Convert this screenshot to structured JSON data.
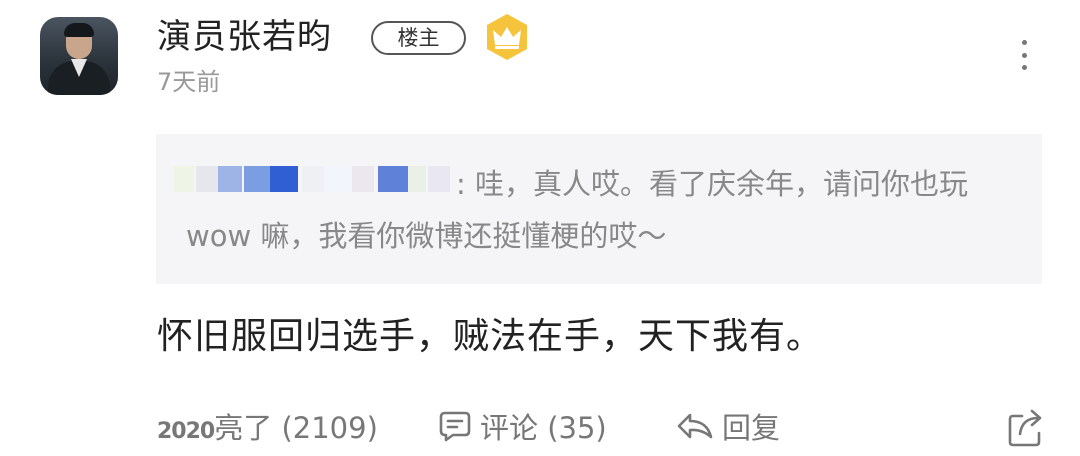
{
  "post": {
    "username": "演员张若昀",
    "op_badge": "楼主",
    "timestamp": "7天前",
    "quote": {
      "text": ": 哇，真人哎。看了庆余年，请问你也玩 wow 嘛，我看你微博还挺懂梗的哎～"
    },
    "content": "怀旧服回归选手，贼法在手，天下我有。",
    "actions": {
      "like_prefix": "2020",
      "like_label": "亮了 (2109)",
      "comment_label": "评论 (35)",
      "reply_label": "回复"
    }
  },
  "icons": {
    "crown": "crown-badge-icon",
    "more": "more-vertical-icon",
    "comment": "comment-icon",
    "reply": "reply-icon",
    "share": "share-icon"
  },
  "colors": {
    "crown_badge": "#f6c33c",
    "quote_background": "#f5f5f7",
    "muted_text": "#888888"
  }
}
